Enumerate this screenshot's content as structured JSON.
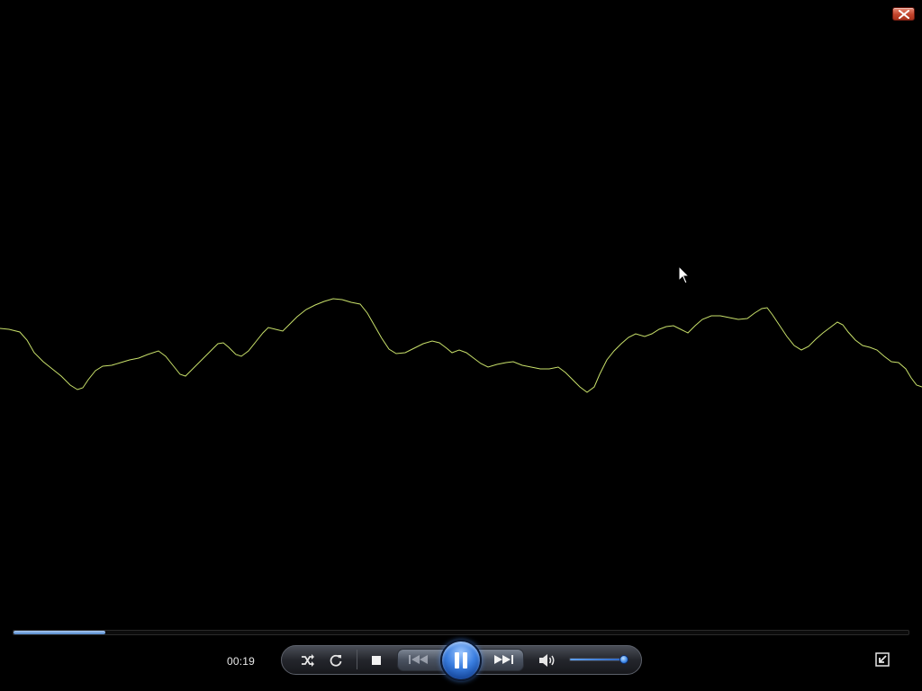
{
  "window": {
    "close_icon": "close-icon",
    "colors": {
      "background": "#000000",
      "waveform": "#c8e06a",
      "accent": "#3a7ee0"
    }
  },
  "visualizer": {
    "type": "waveform",
    "color": "#c8e06a"
  },
  "transport": {
    "time_elapsed": "00:19",
    "progress_fraction": 0.103,
    "state": "playing",
    "buttons": [
      {
        "name": "shuffle",
        "icon": "shuffle-icon"
      },
      {
        "name": "repeat",
        "icon": "repeat-icon"
      },
      {
        "name": "stop",
        "icon": "stop-icon"
      },
      {
        "name": "previous",
        "icon": "skip-previous-icon"
      },
      {
        "name": "pause",
        "icon": "pause-icon"
      },
      {
        "name": "next",
        "icon": "skip-next-icon"
      },
      {
        "name": "mute",
        "icon": "speaker-icon"
      }
    ],
    "volume_fraction": 0.95
  },
  "switch_to_library_icon": "switch-to-library-icon"
}
